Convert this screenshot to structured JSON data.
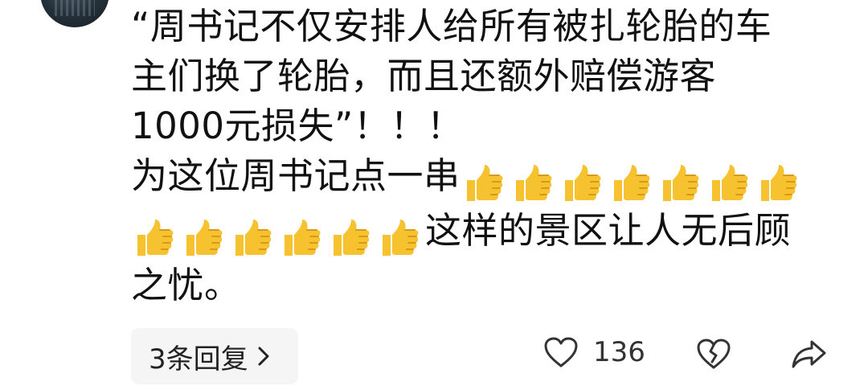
{
  "comment": {
    "lines": [
      "“周书记不仅安排人给所有被扎轮胎的车",
      "主们换了轮胎，而且还额外赔偿游客",
      "1000元损失”！！！",
      "为这位周书记点一串",
      "这样的景区让人无后顾",
      "之忧。"
    ],
    "emoji": "thumbs-up",
    "emoji_count_line4": 7,
    "emoji_count_line5": 6
  },
  "replies": {
    "label": "3条回复"
  },
  "actions": {
    "like_count": "136"
  },
  "colors": {
    "text": "#111111",
    "icon": "#333333",
    "pill_bg": "#f5f5f5",
    "emoji_yellow": "#f7c22f"
  }
}
